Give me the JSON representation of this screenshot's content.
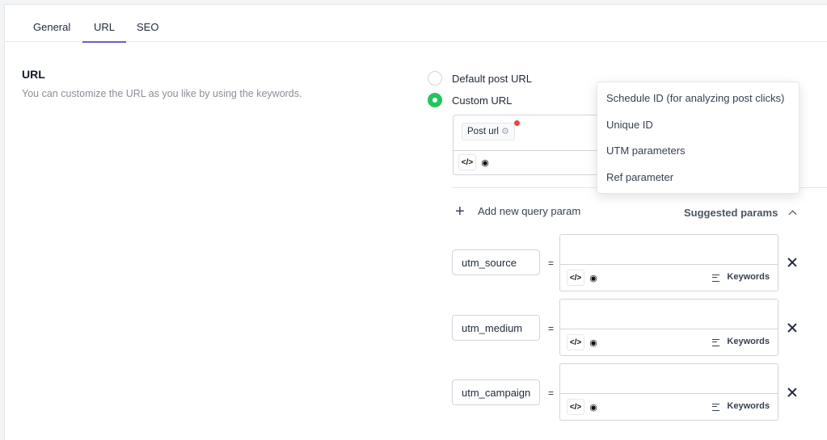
{
  "tabs": [
    {
      "label": "General",
      "active": false
    },
    {
      "label": "URL",
      "active": true
    },
    {
      "label": "SEO",
      "active": false
    }
  ],
  "section": {
    "title": "URL",
    "description": "You can customize the URL as you like by using the keywords."
  },
  "url_options": [
    {
      "label": "Default post URL",
      "selected": false
    },
    {
      "label": "Custom URL",
      "selected": true
    }
  ],
  "url_editor": {
    "chip_label": "Post url",
    "chip_icon": "gear-icon",
    "code_icon": "</>",
    "preview_icon": "eye-icon"
  },
  "query": {
    "add_label": "Add new query param",
    "suggested_label": "Suggested params",
    "params": [
      {
        "name": "utm_source",
        "value": ""
      },
      {
        "name": "utm_medium",
        "value": ""
      },
      {
        "name": "utm_campaign",
        "value": ""
      }
    ],
    "equals": "=",
    "keywords_label": "Keywords"
  },
  "suggested_menu": [
    "Schedule ID (for analyzing post clicks)",
    "Unique ID",
    "UTM parameters",
    "Ref parameter"
  ],
  "colors": {
    "accent": "#6d5bd0",
    "radio_on": "#22c55e",
    "notice_dot": "#ef4444"
  }
}
